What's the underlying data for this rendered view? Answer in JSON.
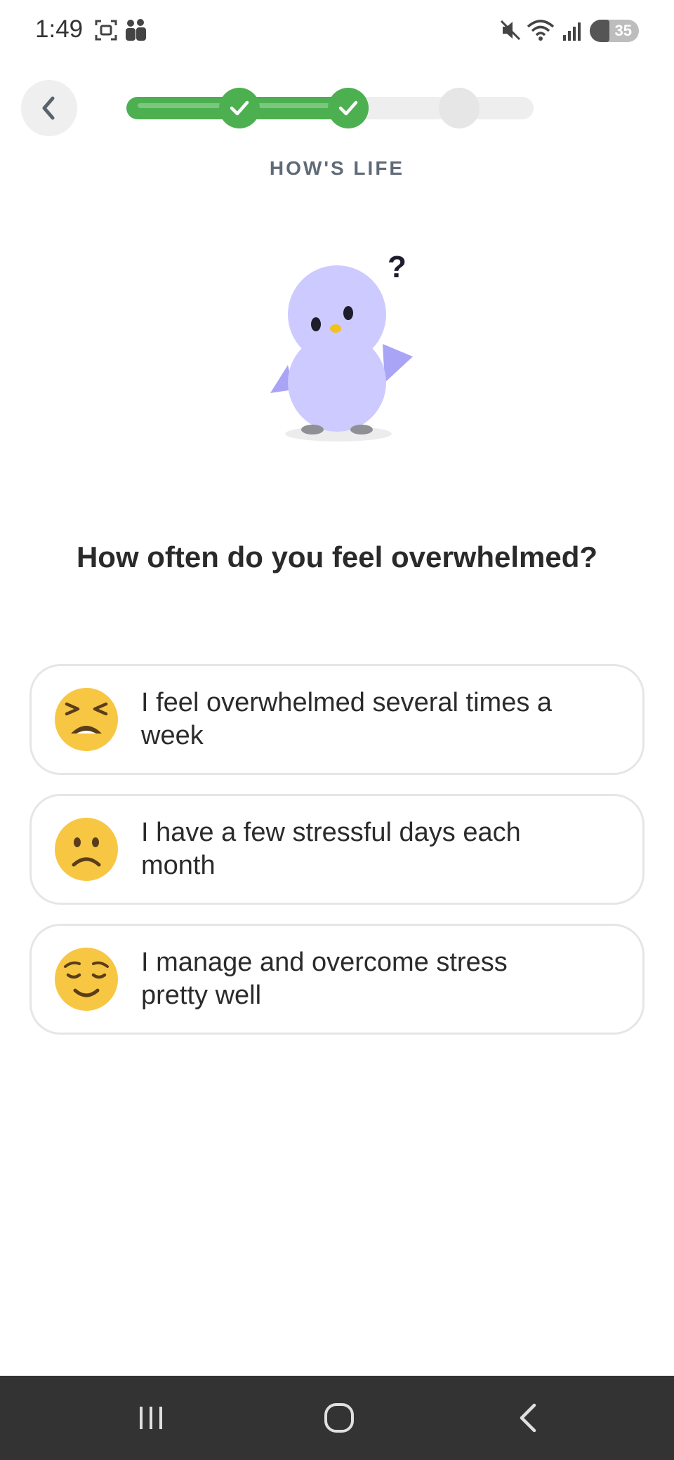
{
  "status_bar": {
    "time": "1:49",
    "battery": "35",
    "icons": [
      "screenshot-icon",
      "people-icon",
      "mute-icon",
      "wifi-icon",
      "signal-icon",
      "battery-icon"
    ]
  },
  "header": {
    "back_icon": "chevron-left-icon",
    "progress": {
      "completed_steps": 2,
      "total_steps": 3
    },
    "section_label": "HOW'S LIFE"
  },
  "mascot": {
    "icon": "penguin-mascot",
    "badge": "?"
  },
  "question": "How often do you feel overwhelmed?",
  "options": [
    {
      "emoji": "tired-face-emoji",
      "label": "I feel overwhelmed several times a week"
    },
    {
      "emoji": "frowning-face-emoji",
      "label": "I have a few stressful days each month"
    },
    {
      "emoji": "relieved-face-emoji",
      "label": "I manage and overcome stress pretty well"
    }
  ],
  "colors": {
    "progress_green": "#4cb050",
    "track_grey": "#eeeeee",
    "label_grey": "#5f6b78",
    "mascot_purple": "#c9c6ff",
    "emoji_yellow": "#f7c744",
    "nav_bg": "#333333"
  },
  "nav_bar": {
    "icons": [
      "recent-apps-icon",
      "home-icon",
      "back-icon"
    ]
  }
}
